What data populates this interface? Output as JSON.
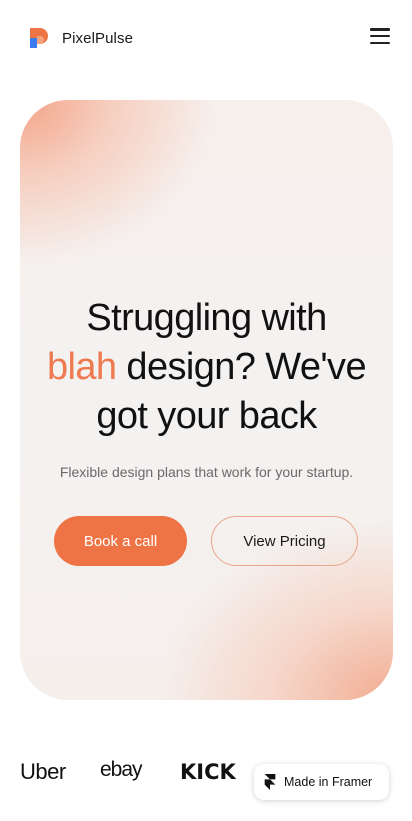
{
  "header": {
    "brand_name": "PixelPulse",
    "menu_icon": "hamburger-menu-icon",
    "logo_colors": {
      "orange": "#ee7446",
      "blue": "#3a7bf0"
    }
  },
  "hero": {
    "headline": {
      "line1": "Struggling with",
      "accent": "blah",
      "line2_rest": " design? We've",
      "line3": "got your back"
    },
    "subtitle": "Flexible design plans that work for your startup.",
    "primary_button": "Book a call",
    "secondary_button": "View Pricing",
    "accent_color": "#ee7446"
  },
  "logos": {
    "items": [
      "Uber",
      "ebay",
      "KICK"
    ]
  },
  "framer_badge": {
    "label": "Made in Framer"
  }
}
